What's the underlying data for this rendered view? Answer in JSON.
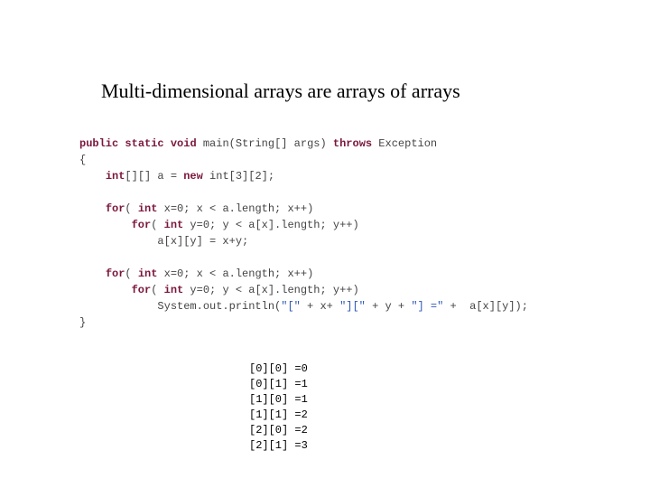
{
  "title": "Multi-dimensional arrays are arrays of arrays",
  "code": {
    "l1_kw1": "public",
    "l1_kw2": "static",
    "l1_kw3": "void",
    "l1_fn": " main(String[] args) ",
    "l1_kw4": "throws",
    "l1_rest": " Exception",
    "l2": "{",
    "l3_pad": "    ",
    "l3_kw1": "int",
    "l3_mid": "[][] a = ",
    "l3_kw2": "new",
    "l3_rest": " int[3][2];",
    "l4_pad": "    ",
    "l4_kw1": "for",
    "l4_mid": "( ",
    "l4_kw2": "int",
    "l4_rest": " x=0; x < a.length; x++)",
    "l5_pad": "        ",
    "l5_kw1": "for",
    "l5_mid": "( ",
    "l5_kw2": "int",
    "l5_rest": " y=0; y < a[x].length; y++)",
    "l6": "            a[x][y] = x+y;",
    "l7_pad": "    ",
    "l7_kw1": "for",
    "l7_mid": "( ",
    "l7_kw2": "int",
    "l7_rest": " x=0; x < a.length; x++)",
    "l8_pad": "        ",
    "l8_kw1": "for",
    "l8_mid": "( ",
    "l8_kw2": "int",
    "l8_rest": " y=0; y < a[x].length; y++)",
    "l9_pad": "            System.out.println(",
    "l9_s1": "\"[\"",
    "l9_p1": " + x+ ",
    "l9_s2": "\"][\"",
    "l9_p2": " + y + ",
    "l9_s3": "\"] =\"",
    "l9_p3": " +  a[x][y]);",
    "l10": "}"
  },
  "output": {
    "r1": "[0][0] =0",
    "r2": "[0][1] =1",
    "r3": "[1][0] =1",
    "r4": "[1][1] =2",
    "r5": "[2][0] =2",
    "r6": "[2][1] =3"
  }
}
